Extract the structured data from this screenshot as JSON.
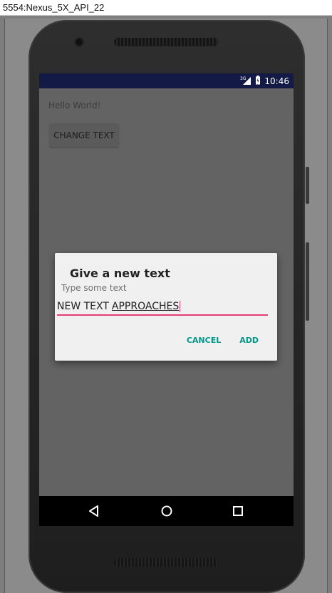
{
  "window": {
    "title": "5554:Nexus_5X_API_22"
  },
  "status_bar": {
    "network": "3G",
    "time": "10:46"
  },
  "app": {
    "hello_text": "Hello World!",
    "change_text_button": "CHANGE TEXT"
  },
  "dialog": {
    "title": "Give a new text",
    "hint": "Type some text",
    "input_value_plain": "NEW TEXT",
    "input_value_underlined": "APPROACHES",
    "cancel_label": "CANCEL",
    "add_label": "ADD"
  },
  "nav": {
    "back_icon": "back-icon",
    "home_icon": "home-icon",
    "recents_icon": "recents-icon"
  },
  "colors": {
    "status_bar": "#141a46",
    "dialog_accent": "#00968a",
    "input_underline": "#e63d7a"
  }
}
